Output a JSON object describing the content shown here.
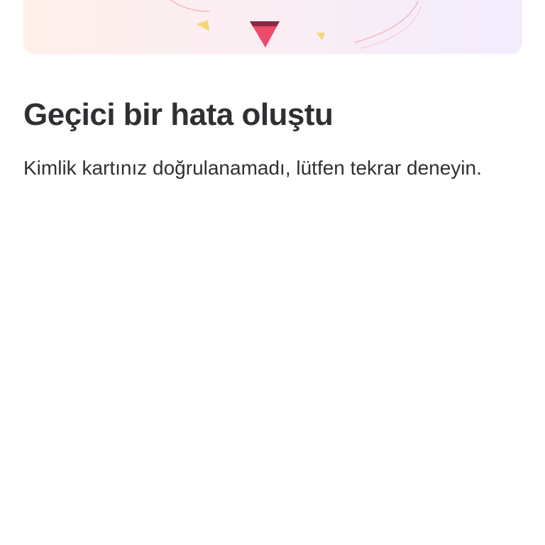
{
  "header_illustration": {
    "icon": "confetti-illustration",
    "colors": {
      "background_start": "#fff0ea",
      "background_end": "#f2ecfd",
      "triangle_red": "#ee4a6b",
      "triangle_red_dark": "#8e2741",
      "triangle_yellow": "#f5d77a",
      "streamer": "#f3b9c4"
    }
  },
  "error": {
    "title": "Geçici bir hata oluştu",
    "message": "Kimlik kartınız doğrulanamadı, lütfen tekrar deneyin."
  }
}
